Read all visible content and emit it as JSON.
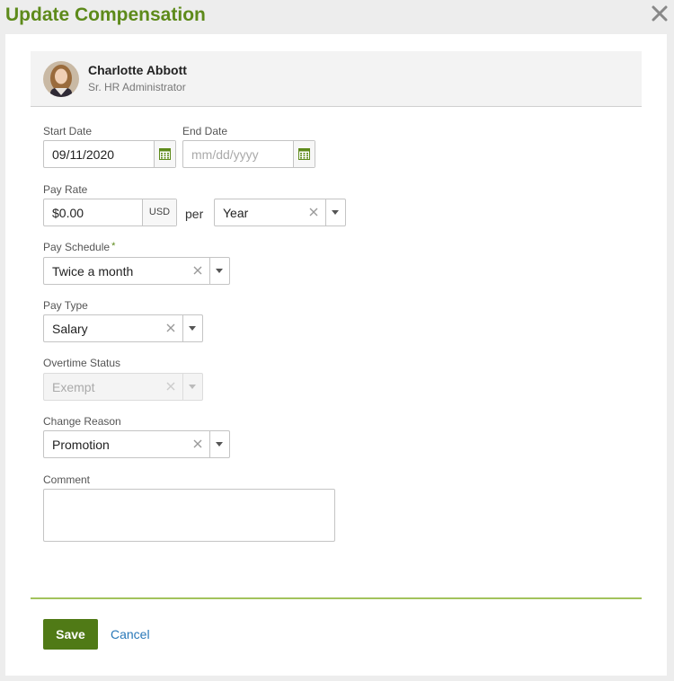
{
  "dialog": {
    "title": "Update Compensation"
  },
  "employee": {
    "name": "Charlotte Abbott",
    "role": "Sr. HR Administrator"
  },
  "form": {
    "start_date": {
      "label": "Start Date",
      "value": "09/11/2020"
    },
    "end_date": {
      "label": "End Date",
      "value": "",
      "placeholder": "mm/dd/yyyy"
    },
    "pay_rate": {
      "label": "Pay Rate",
      "value": "$0.00",
      "currency": "USD",
      "per_label": "per",
      "period": "Year"
    },
    "pay_schedule": {
      "label": "Pay Schedule",
      "required_mark": "*",
      "value": "Twice a month"
    },
    "pay_type": {
      "label": "Pay Type",
      "value": "Salary"
    },
    "overtime_status": {
      "label": "Overtime Status",
      "value": "Exempt"
    },
    "change_reason": {
      "label": "Change Reason",
      "value": "Promotion"
    },
    "comment": {
      "label": "Comment",
      "value": ""
    }
  },
  "actions": {
    "save_label": "Save",
    "cancel_label": "Cancel"
  },
  "icons": {
    "close": "close-icon",
    "calendar": "calendar-icon",
    "clear": "clear-icon",
    "caret": "chevron-down-icon"
  },
  "colors": {
    "brand_green": "#5d8a1a",
    "save_button": "#507a16",
    "link_blue": "#2878b8",
    "divider": "#a2c35c"
  }
}
